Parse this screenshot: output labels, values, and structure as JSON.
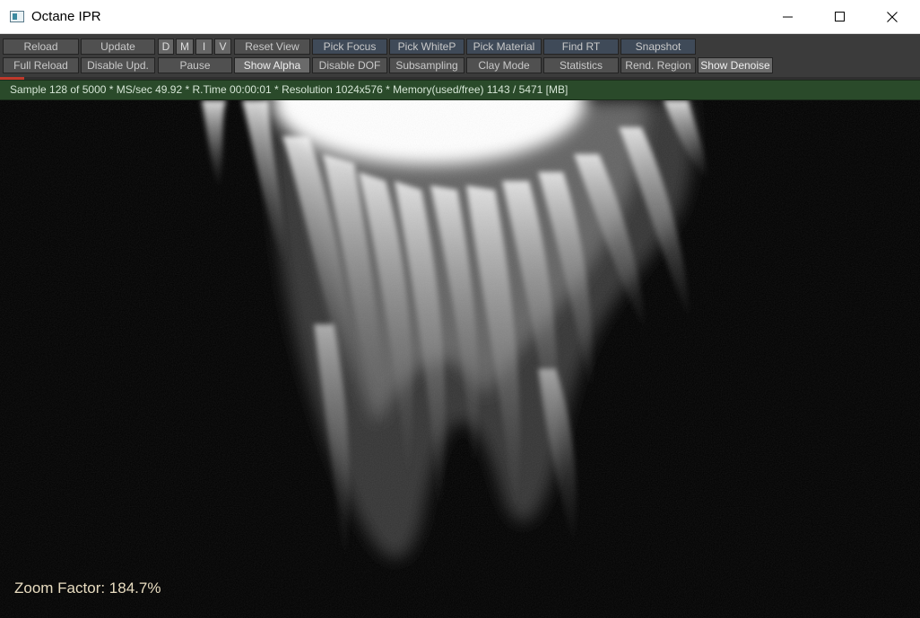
{
  "window": {
    "title": "Octane IPR",
    "icons": [
      "app-icon",
      "minimize-icon",
      "maximize-icon",
      "close-icon"
    ]
  },
  "toolbar": {
    "row1": {
      "reload": "Reload",
      "update": "Update",
      "d": "D",
      "m": "M",
      "i": "I",
      "v": "V",
      "reset_view": "Reset View",
      "pick_focus": "Pick Focus",
      "pick_whitep": "Pick WhiteP",
      "pick_material": "Pick Material",
      "find_rt": "Find RT",
      "snapshot": "Snapshot"
    },
    "row2": {
      "full_reload": "Full Reload",
      "disable_upd": "Disable Upd.",
      "pause": "Pause",
      "show_alpha": "Show Alpha",
      "disable_dof": "Disable DOF",
      "subsampling": "Subsampling",
      "clay_mode": "Clay Mode",
      "statistics": "Statistics",
      "rend_region": "Rend. Region",
      "show_denoise": "Show Denoise"
    }
  },
  "render_progress": 0.026,
  "status": {
    "text": "Sample 128 of 5000 * MS/sec 49.92 * R.Time 00:00:01 * Resolution 1024x576 * Memory(used/free) 1143 / 5471 [MB]"
  },
  "viewport": {
    "zoom_label": "Zoom Factor: 184.7%"
  }
}
